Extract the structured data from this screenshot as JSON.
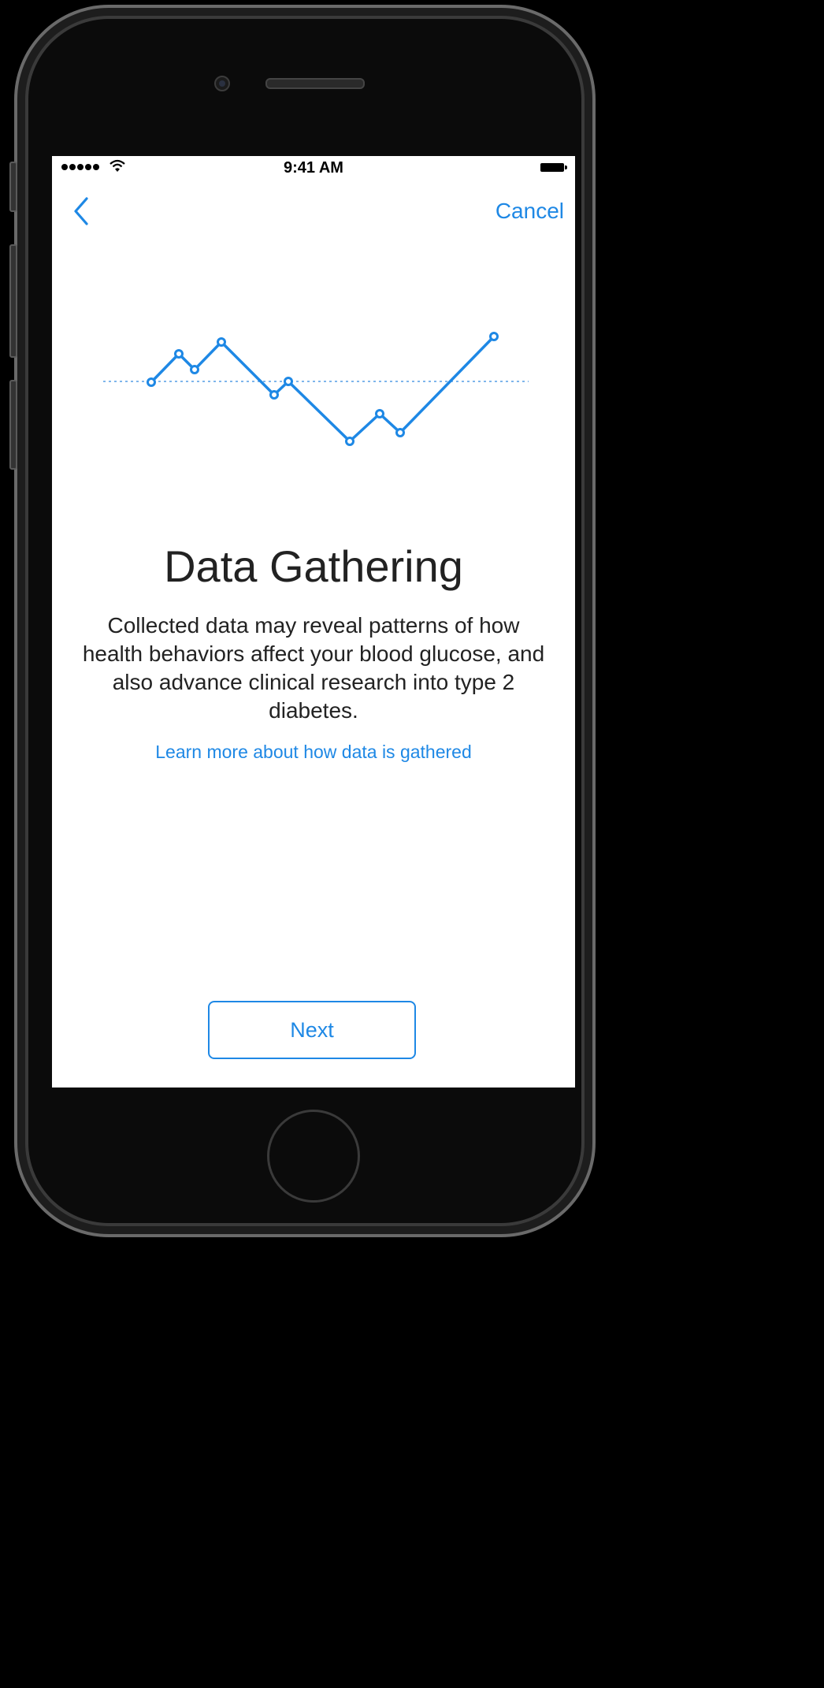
{
  "status_bar": {
    "time": "9:41 AM"
  },
  "nav": {
    "back_icon": "chevron-left-icon",
    "cancel_label": "Cancel"
  },
  "content": {
    "title": "Data Gathering",
    "body": "Collected data may reveal patterns of how health behaviors affect your blood glucose, and also advance clinical research into type 2 diabetes.",
    "link_label": "Learn more about how data is gathered"
  },
  "footer": {
    "next_label": "Next"
  },
  "colors": {
    "accent": "#1e88e5",
    "text": "#222222",
    "background": "#ffffff"
  }
}
